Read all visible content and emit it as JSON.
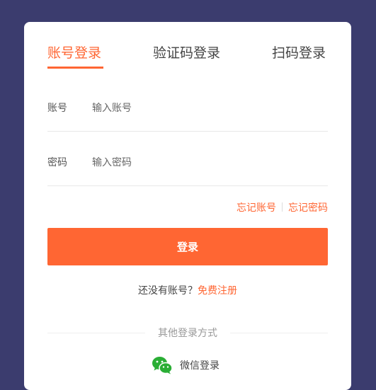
{
  "tabs": [
    {
      "label": "账号登录",
      "active": true
    },
    {
      "label": "验证码登录",
      "active": false
    },
    {
      "label": "扫码登录",
      "active": false
    }
  ],
  "form": {
    "account_label": "账号",
    "account_placeholder": "输入账号",
    "password_label": "密码",
    "password_placeholder": "输入密码"
  },
  "links": {
    "forgot_account": "忘记账号",
    "forgot_password": "忘记密码"
  },
  "login_button": "登录",
  "register": {
    "prompt": "还没有账号？",
    "link": "免费注册"
  },
  "other_login": {
    "label": "其他登录方式",
    "wechat": "微信登录"
  },
  "colors": {
    "accent": "#ff6633",
    "background": "#3b3c6e",
    "wechat_green": "#2aae35"
  }
}
